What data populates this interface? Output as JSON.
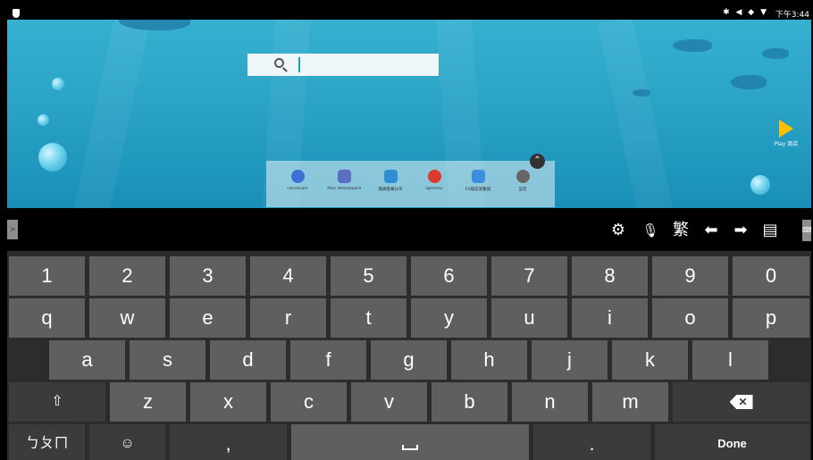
{
  "status_bar": {
    "icons": "✱ ◀ ◆ ▼",
    "time": "下午3:44"
  },
  "search": {
    "placeholder": ""
  },
  "play_store": {
    "label": "Play 商店"
  },
  "dock": {
    "apps": [
      {
        "name": "chromium",
        "label": "Chromium",
        "color": "#3a6fd6"
      },
      {
        "name": "aver-whiteboard",
        "label": "AVer Whiteboard",
        "color": "#5a6fbf"
      },
      {
        "name": "screen-share",
        "label": "無線螢幕分享",
        "color": "#2b8fd1"
      },
      {
        "name": "sphere2",
        "label": "Sphere2",
        "color": "#d93a2b"
      },
      {
        "name": "es-file-manager",
        "label": "ES檔案瀏覽器",
        "color": "#3e8ee0"
      },
      {
        "name": "settings",
        "label": "設定",
        "color": "#666666"
      }
    ],
    "collapse_glyph": "⌃"
  },
  "toolbar": {
    "expand_glyph": ">",
    "buttons": [
      {
        "name": "settings",
        "glyph": "⚙"
      },
      {
        "name": "microphone",
        "glyph": "🎙"
      },
      {
        "name": "traditional",
        "glyph": "繁"
      },
      {
        "name": "arrow-left",
        "glyph": "⬅"
      },
      {
        "name": "arrow-right",
        "glyph": "➡"
      },
      {
        "name": "clipboard",
        "glyph": "▤"
      }
    ],
    "edge_glyph": "⌨"
  },
  "keyboard": {
    "row1": [
      "1",
      "2",
      "3",
      "4",
      "5",
      "6",
      "7",
      "8",
      "9",
      "0"
    ],
    "row2": [
      "q",
      "w",
      "e",
      "r",
      "t",
      "y",
      "u",
      "i",
      "o",
      "p"
    ],
    "row3": [
      "a",
      "s",
      "d",
      "f",
      "g",
      "h",
      "j",
      "k",
      "l"
    ],
    "row4": [
      "z",
      "x",
      "c",
      "v",
      "b",
      "n",
      "m"
    ],
    "shift_glyph": "⇧",
    "zhuyin_label": "ㄅㄆㄇ",
    "emoji_glyph": "☺",
    "comma": ",",
    "period": ".",
    "done_label": "Done"
  }
}
